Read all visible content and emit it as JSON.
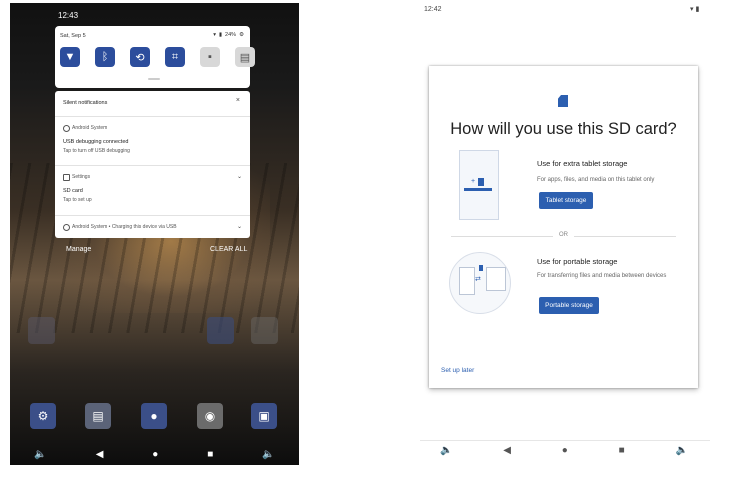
{
  "left": {
    "status_time": "12:43",
    "quick_settings": {
      "date": "Sat, Sep 5",
      "battery": "24%",
      "tiles": [
        {
          "name": "wifi-icon",
          "glyph": "▼",
          "active": true
        },
        {
          "name": "bluetooth-icon",
          "glyph": "ᛒ",
          "active": true
        },
        {
          "name": "auto-rotate-icon",
          "glyph": "⟲",
          "active": true
        },
        {
          "name": "crop-icon",
          "glyph": "⌗",
          "active": true
        },
        {
          "name": "camera-icon",
          "glyph": "▪",
          "active": false
        },
        {
          "name": "tablet-mode-icon",
          "glyph": "▤",
          "active": false
        }
      ]
    },
    "notifications": {
      "header": "Silent notifications",
      "close_glyph": "×",
      "items": [
        {
          "app": "Android System",
          "title": "USB debugging connected",
          "subtitle": "Tap to turn off USB debugging"
        },
        {
          "app": "Settings",
          "title": "SD card",
          "subtitle": "Tap to set up"
        },
        {
          "app": "Android System • Charging this device via USB",
          "title": "",
          "subtitle": ""
        }
      ]
    },
    "manage_label": "Manage",
    "clear_all_label": "CLEAR ALL",
    "nav": [
      "🔈",
      "◀",
      "●",
      "■",
      "🔈"
    ]
  },
  "right": {
    "status_time": "12:42",
    "dialog": {
      "title": "How will you use this SD card?",
      "option1": {
        "title": "Use for extra tablet storage",
        "desc": "For apps, files, and media on this tablet only",
        "button": "Tablet storage"
      },
      "or_label": "OR",
      "option2": {
        "title": "Use for portable storage",
        "desc": "For transferring files and media between devices",
        "button": "Portable storage"
      },
      "setup_later": "Set up later"
    },
    "nav": [
      "🔈",
      "◀",
      "●",
      "■",
      "🔈"
    ]
  }
}
